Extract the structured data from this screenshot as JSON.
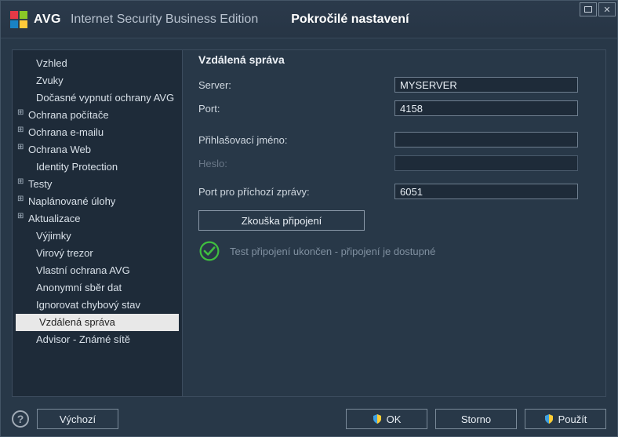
{
  "header": {
    "brand": "AVG",
    "edition": "Internet Security Business Edition",
    "dialog_title": "Pokročilé nastavení"
  },
  "sidebar": {
    "items": [
      {
        "label": "Vzhled",
        "expandable": false,
        "indent": true,
        "selected": false,
        "name": "sidebar-item-vzhled"
      },
      {
        "label": "Zvuky",
        "expandable": false,
        "indent": true,
        "selected": false,
        "name": "sidebar-item-zvuky"
      },
      {
        "label": "Dočasné vypnutí ochrany AVG",
        "expandable": false,
        "indent": true,
        "selected": false,
        "name": "sidebar-item-docasne-vypnuti"
      },
      {
        "label": "Ochrana počítače",
        "expandable": true,
        "indent": false,
        "selected": false,
        "name": "sidebar-item-ochrana-pocitace"
      },
      {
        "label": "Ochrana e-mailu",
        "expandable": true,
        "indent": false,
        "selected": false,
        "name": "sidebar-item-ochrana-emailu"
      },
      {
        "label": "Ochrana Web",
        "expandable": true,
        "indent": false,
        "selected": false,
        "name": "sidebar-item-ochrana-web"
      },
      {
        "label": "Identity Protection",
        "expandable": false,
        "indent": true,
        "selected": false,
        "name": "sidebar-item-identity-protection"
      },
      {
        "label": "Testy",
        "expandable": true,
        "indent": false,
        "selected": false,
        "name": "sidebar-item-testy"
      },
      {
        "label": "Naplánované úlohy",
        "expandable": true,
        "indent": false,
        "selected": false,
        "name": "sidebar-item-naplanovane-ulohy"
      },
      {
        "label": "Aktualizace",
        "expandable": true,
        "indent": false,
        "selected": false,
        "name": "sidebar-item-aktualizace"
      },
      {
        "label": "Výjimky",
        "expandable": false,
        "indent": true,
        "selected": false,
        "name": "sidebar-item-vyjimky"
      },
      {
        "label": "Virový trezor",
        "expandable": false,
        "indent": true,
        "selected": false,
        "name": "sidebar-item-virovy-trezor"
      },
      {
        "label": "Vlastní ochrana AVG",
        "expandable": false,
        "indent": true,
        "selected": false,
        "name": "sidebar-item-vlastni-ochrana"
      },
      {
        "label": "Anonymní sběr dat",
        "expandable": false,
        "indent": true,
        "selected": false,
        "name": "sidebar-item-anonymni-sber"
      },
      {
        "label": "Ignorovat chybový stav",
        "expandable": false,
        "indent": true,
        "selected": false,
        "name": "sidebar-item-ignorovat-chybovy"
      },
      {
        "label": "Vzdálená správa",
        "expandable": false,
        "indent": true,
        "selected": true,
        "name": "sidebar-item-vzdalena-sprava"
      },
      {
        "label": "Advisor - Známé sítě",
        "expandable": false,
        "indent": true,
        "selected": false,
        "name": "sidebar-item-advisor-site"
      }
    ]
  },
  "content": {
    "section_title": "Vzdálená správa",
    "fields": {
      "server": {
        "label": "Server:",
        "value": "MYSERVER"
      },
      "port": {
        "label": "Port:",
        "value": "4158"
      },
      "login": {
        "label": "Přihlašovací jméno:",
        "value": ""
      },
      "password": {
        "label": "Heslo:",
        "value": ""
      },
      "incoming_port": {
        "label": "Port pro příchozí zprávy:",
        "value": "6051"
      }
    },
    "test_button": "Zkouška připojení",
    "status_text": "Test připojení ukončen - připojení je dostupné"
  },
  "footer": {
    "default_label": "Výchozí",
    "ok_label": "OK",
    "cancel_label": "Storno",
    "apply_label": "Použít"
  }
}
